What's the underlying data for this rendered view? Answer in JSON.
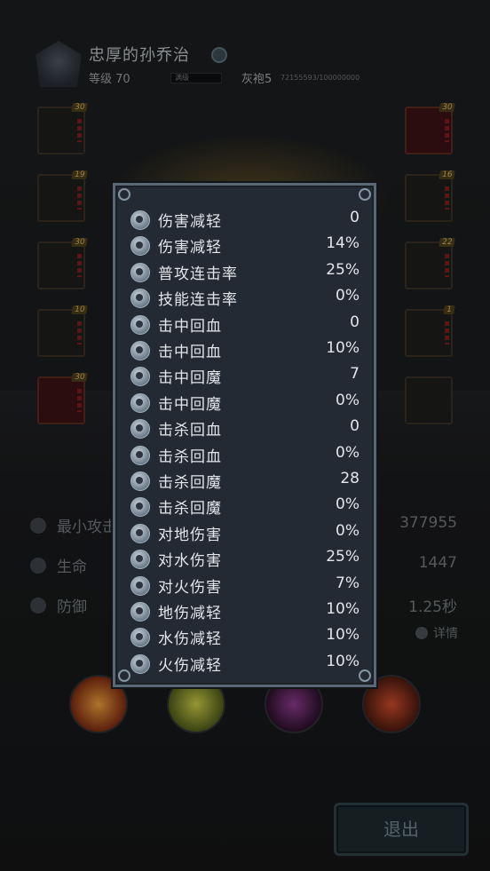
{
  "header": {
    "player_name": "忠厚的孙乔治",
    "level_text": "等级 70",
    "exp_label": "满级",
    "rank_text": "灰袍5",
    "power_text": "72155593/100000000"
  },
  "equipment": {
    "left_levels": [
      "30",
      "19",
      "30",
      "10",
      "30"
    ],
    "right_levels": [
      "30",
      "16",
      "22",
      "1",
      ""
    ]
  },
  "stats": {
    "rows": [
      {
        "label": "最小攻击",
        "value": "377955"
      },
      {
        "label": "生命",
        "value": "1447"
      },
      {
        "label": "防御",
        "value": "1.25秒"
      }
    ],
    "detail_label": "详情"
  },
  "exit_label": "退出",
  "popup": {
    "rows": [
      {
        "label": "伤害减轻",
        "value": "0",
        "icon": "shield-icon"
      },
      {
        "label": "伤害减轻",
        "value": "14%",
        "icon": "shield-icon"
      },
      {
        "label": "普攻连击率",
        "value": "25%",
        "icon": "combo-icon"
      },
      {
        "label": "技能连击率",
        "value": "0%",
        "icon": "skill-combo-icon"
      },
      {
        "label": "击中回血",
        "value": "0",
        "icon": "hit-heal-icon"
      },
      {
        "label": "击中回血",
        "value": "10%",
        "icon": "hit-heal-icon"
      },
      {
        "label": "击中回魔",
        "value": "7",
        "icon": "hit-mana-icon"
      },
      {
        "label": "击中回魔",
        "value": "0%",
        "icon": "hit-mana-icon"
      },
      {
        "label": "击杀回血",
        "value": "0",
        "icon": "kill-heal-icon"
      },
      {
        "label": "击杀回血",
        "value": "0%",
        "icon": "kill-heal-icon"
      },
      {
        "label": "击杀回魔",
        "value": "28",
        "icon": "kill-mana-icon"
      },
      {
        "label": "击杀回魔",
        "value": "0%",
        "icon": "kill-mana-icon"
      },
      {
        "label": "对地伤害",
        "value": "0%",
        "icon": "earth-icon"
      },
      {
        "label": "对水伤害",
        "value": "25%",
        "icon": "water-icon"
      },
      {
        "label": "对火伤害",
        "value": "7%",
        "icon": "fire-icon"
      },
      {
        "label": "地伤减轻",
        "value": "10%",
        "icon": "earth-resist-icon"
      },
      {
        "label": "水伤减轻",
        "value": "10%",
        "icon": "water-resist-icon"
      },
      {
        "label": "火伤减轻",
        "value": "10%",
        "icon": "fire-resist-icon"
      }
    ]
  }
}
